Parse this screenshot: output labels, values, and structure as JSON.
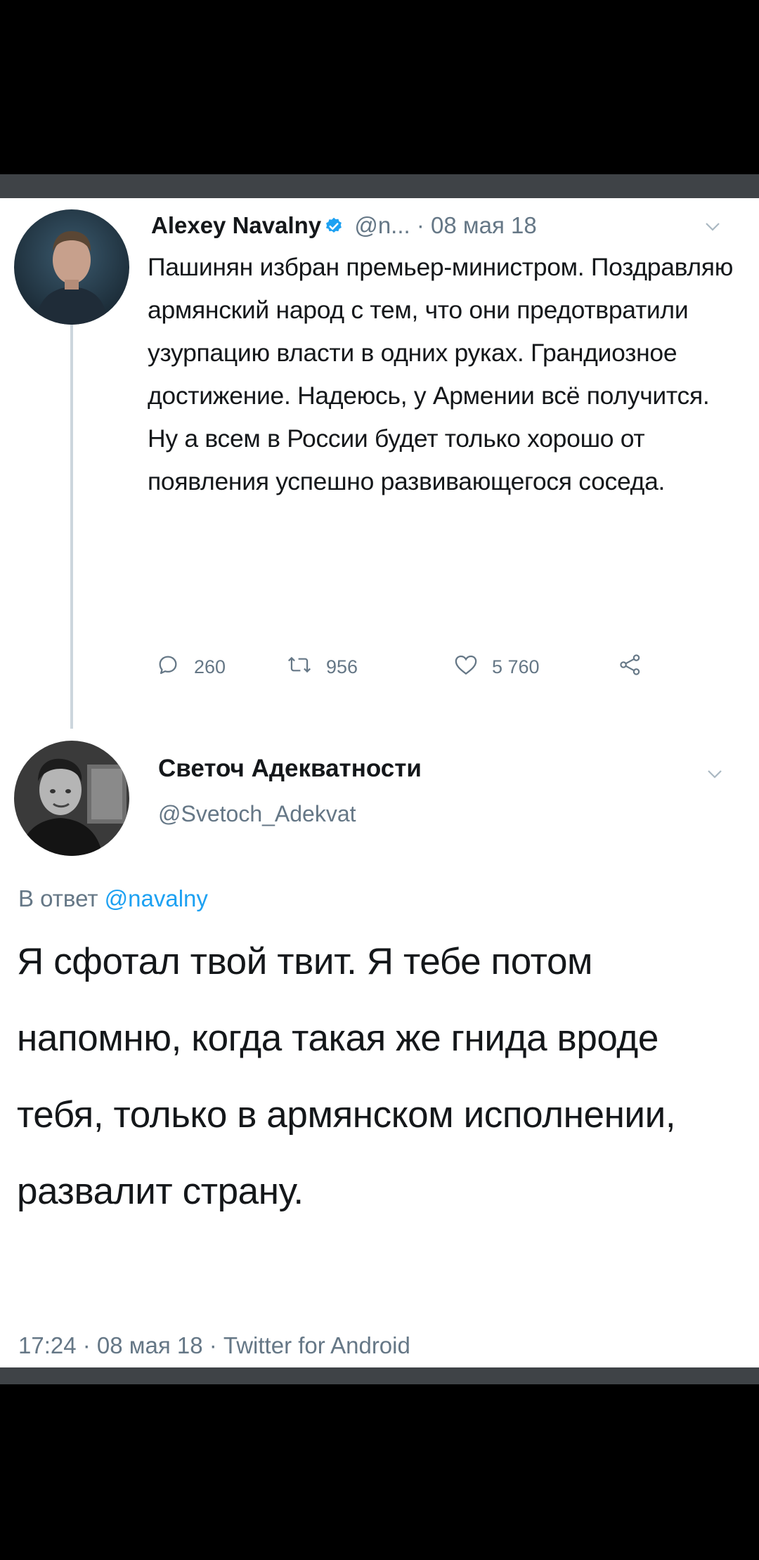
{
  "tweet": {
    "author_name": "Alexey Navalny",
    "author_handle_truncated": "@n...",
    "separator": "·",
    "date": "08 мая 18",
    "text": "Пашинян избран премьер-министром. Поздравляю армянский народ с тем, что они предотвратили узурпацию власти в одних руках. Грандиозное достижение. Надеюсь, у Армении всё получится. Ну а всем в России будет только хорошо от появления успешно развивающегося соседа.",
    "replies": "260",
    "retweets": "956",
    "likes": "5 760"
  },
  "reply": {
    "author_name": "Светоч Адекватности",
    "author_handle": "@Svetoch_Adekvat",
    "reply_to_label": "В ответ",
    "reply_to_handle": "@navalny",
    "text": "Я сфотал твой твит. Я тебе потом напомню, когда такая же гнида вроде тебя, только в армянском исполнении, развалит страну.",
    "meta": "17:24 · 08 мая 18 · Twitter for Android"
  },
  "colors": {
    "text_primary": "#14171a",
    "text_secondary": "#657786",
    "link": "#1da1f2",
    "verified": "#1da1f2",
    "thread_line": "#ccd6dd"
  },
  "icons": [
    "verified-badge-icon",
    "chevron-down-icon",
    "reply-icon",
    "retweet-icon",
    "like-icon",
    "share-icon"
  ]
}
